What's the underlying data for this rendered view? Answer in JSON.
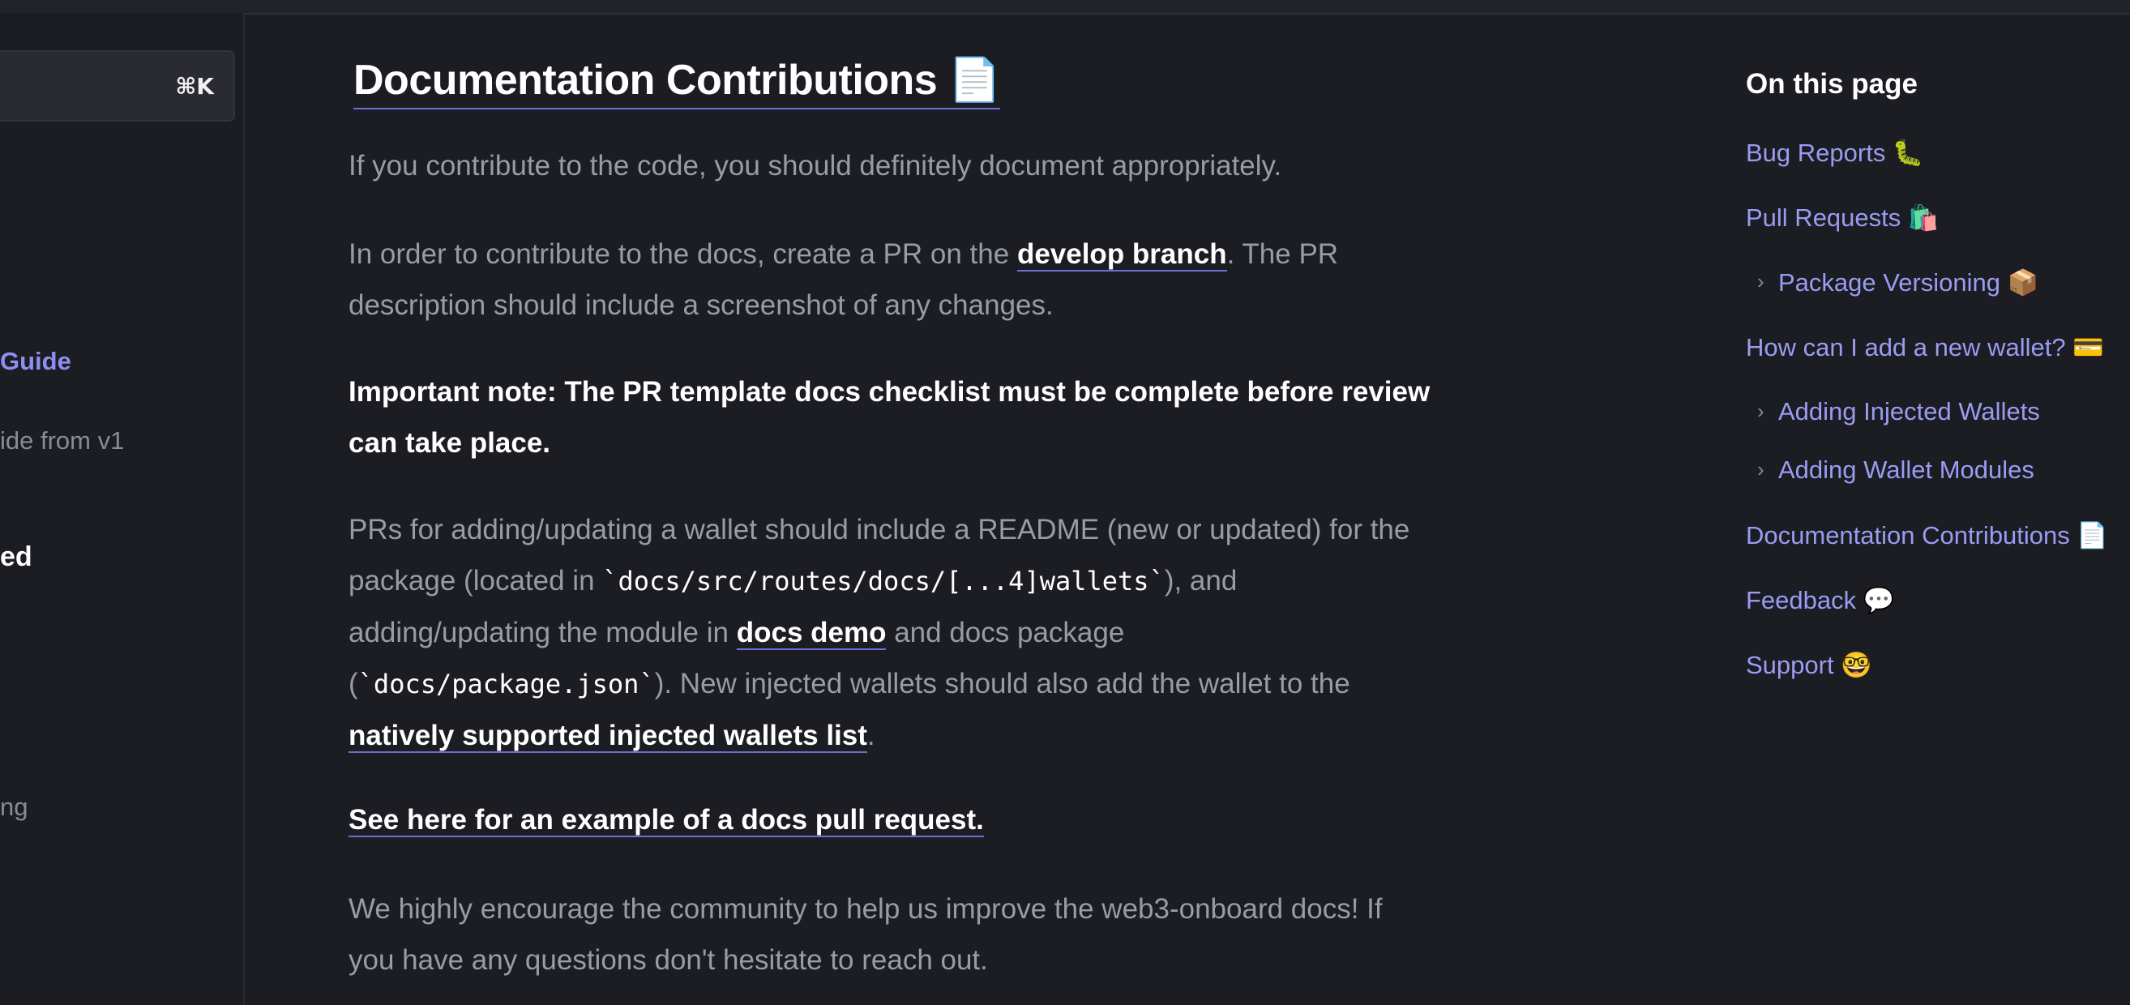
{
  "sidebar": {
    "search_shortcut": "⌘K",
    "items": [
      {
        "label": "Guide"
      },
      {
        "label": "ide from v1"
      },
      {
        "label": "ed"
      },
      {
        "label": "ng"
      }
    ]
  },
  "main": {
    "title": "Documentation Contributions",
    "title_emoji": "📄",
    "p1": "If you contribute to the code, you should definitely document appropriately.",
    "p2": {
      "before": "In order to contribute to the docs, create a PR on the ",
      "link": "develop branch",
      "after": ". The PR description should include a screenshot of any changes."
    },
    "p3": "Important note: The PR template docs checklist must be complete before review can take place.",
    "p4": {
      "t1": "PRs for adding/updating a wallet should include a README (new or updated) for the package (located in ",
      "code1": "`docs/src/routes/docs/[...4]wallets`",
      "t2": "), and adding/updating the module in ",
      "link1": "docs demo",
      "t3": " and docs package (",
      "code2": "`docs/package.json`",
      "t4": "). New injected wallets should also add the wallet to the ",
      "link2": "natively supported injected wallets list",
      "t5": "."
    },
    "p5_link": "See here for an example of a docs pull request.",
    "p6": "We highly encourage the community to help us improve the web3-onboard docs! If you have any questions don't hesitate to reach out."
  },
  "toc": {
    "heading": "On this page",
    "items": [
      {
        "label": "Bug Reports 🐛",
        "icon": "bug-emoji"
      },
      {
        "label": "Pull Requests 🛍️",
        "icon": "shopping-bag-emoji"
      },
      {
        "label": "Package Versioning 📦",
        "icon": "package-emoji"
      },
      {
        "label": "How can I add a new wallet? 💳",
        "icon": "card-emoji"
      },
      {
        "label": "Adding Injected Wallets"
      },
      {
        "label": "Adding Wallet Modules"
      },
      {
        "label": "Documentation Contributions 📄",
        "icon": "page-emoji"
      },
      {
        "label": "Feedback 💬",
        "icon": "speech-bubble-emoji"
      },
      {
        "label": "Support 🤓",
        "icon": "nerd-face-emoji"
      }
    ],
    "chevron": "›"
  }
}
